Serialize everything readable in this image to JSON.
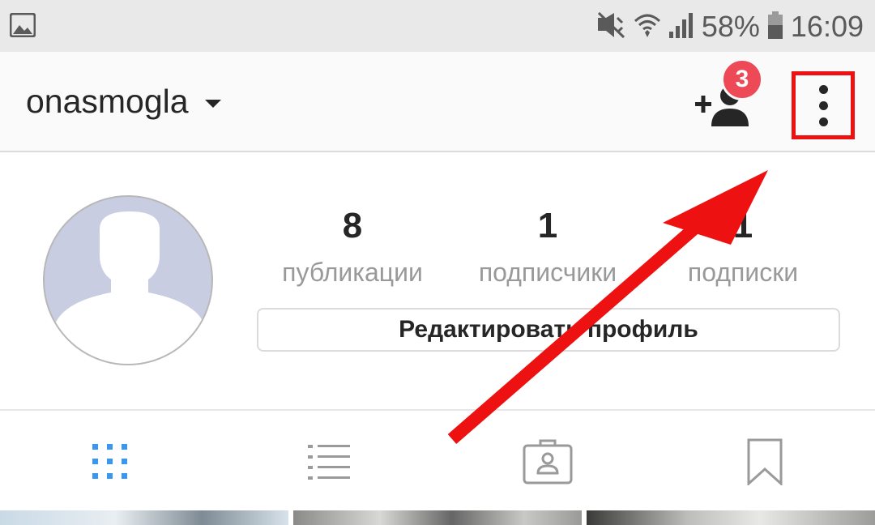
{
  "status_bar": {
    "battery": "58%",
    "time": "16:09"
  },
  "header": {
    "username": "onasmogla",
    "badge_count": "3"
  },
  "profile": {
    "stats": [
      {
        "value": "8",
        "label": "публикации"
      },
      {
        "value": "1",
        "label": "подписчики"
      },
      {
        "value": "1",
        "label": "подписки"
      }
    ],
    "edit_button_label": "Редактировать профиль"
  },
  "tabs": [
    {
      "icon": "grid-icon",
      "active": true
    },
    {
      "icon": "list-icon",
      "active": false
    },
    {
      "icon": "tagged-icon",
      "active": false
    },
    {
      "icon": "bookmark-icon",
      "active": false
    }
  ],
  "colors": {
    "accent_blue": "#3897f0",
    "badge_red": "#ed4956",
    "annotation_red": "#ee1111",
    "text_dark": "#262626",
    "text_muted": "#999999"
  }
}
